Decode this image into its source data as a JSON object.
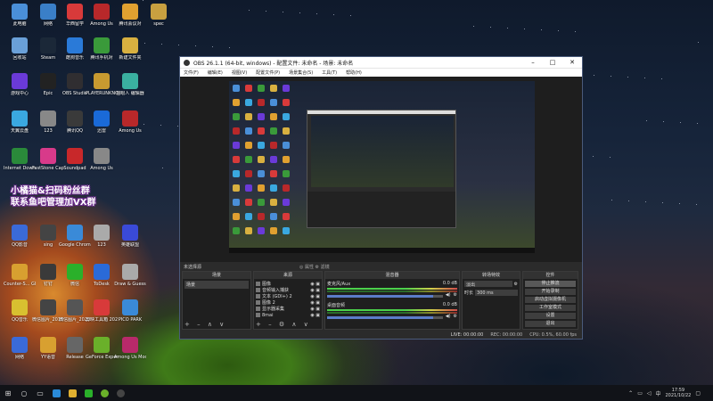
{
  "desktop": {
    "icons": [
      {
        "label": "此电脑",
        "color": "#4a8fd8"
      },
      {
        "label": "网络",
        "color": "#3a7fc8"
      },
      {
        "label": "华西留学",
        "color": "#d83a3a"
      },
      {
        "label": "Among Us",
        "color": "#b8282a"
      },
      {
        "label": "腾讯会议对",
        "color": "#e0a030"
      },
      {
        "label": "spec",
        "color": "#c8a040"
      },
      {
        "label": "回收站",
        "color": "#6aa0d8"
      },
      {
        "label": "Steam",
        "color": "#1b2838"
      },
      {
        "label": "酷狗音乐",
        "color": "#2a7ad8"
      },
      {
        "label": "腾讯手机对",
        "color": "#3a9a3a"
      },
      {
        "label": "新建文件夹",
        "color": "#d8b040"
      },
      {
        "label": "游戏中心",
        "color": "#6a3ad8"
      },
      {
        "label": "Epic",
        "color": "#222"
      },
      {
        "label": "OBS Studio",
        "color": "#302e31"
      },
      {
        "label": "PLAYERUNKNOWN'S BATTLEG...",
        "color": "#c89a30"
      },
      {
        "label": "猫眼人 编辑器",
        "color": "#3ab0a0"
      },
      {
        "label": "天翼云盘",
        "color": "#3aa8e0"
      },
      {
        "label": "123",
        "color": "#888"
      },
      {
        "label": "腾讯QQ",
        "color": "#3a3a3a"
      },
      {
        "label": "迅雷",
        "color": "#1a6ad8"
      },
      {
        "label": "Among Us",
        "color": "#b8282a"
      },
      {
        "label": "Internet Downlo...",
        "color": "#2a8a3a"
      },
      {
        "label": "FastStone Capture",
        "color": "#d83a8a"
      },
      {
        "label": "Soundpad",
        "color": "#c8282a"
      },
      {
        "label": "Among Us",
        "color": "#888"
      },
      {
        "label": "QQ影音",
        "color": "#3a6ad8"
      },
      {
        "label": "sing",
        "color": "#444"
      },
      {
        "label": "Google Chrome",
        "color": "#3a8ad8"
      },
      {
        "label": "123",
        "color": "#aaa"
      },
      {
        "label": "英雄联盟",
        "color": "#3a4ad8"
      },
      {
        "label": "Counter-S... Global Off...",
        "color": "#d8a030"
      },
      {
        "label": "钉钉",
        "color": "#3a3a3a"
      },
      {
        "label": "微信",
        "color": "#2ab02a"
      },
      {
        "label": "ToDesk",
        "color": "#2a6ad8"
      },
      {
        "label": "Draw & Guess",
        "color": "#aaa"
      },
      {
        "label": "QQ音乐",
        "color": "#d8c030"
      },
      {
        "label": "微信图片_2018101...",
        "color": "#444"
      },
      {
        "label": "微信图片_2020101...",
        "color": "#555"
      },
      {
        "label": "剪映工具箱 2020",
        "color": "#d83a3a"
      },
      {
        "label": "PICO PARK",
        "color": "#3a8ad8"
      },
      {
        "label": "网络",
        "color": "#3a6ad8"
      },
      {
        "label": "YY语音",
        "color": "#d8a030"
      },
      {
        "label": "Release",
        "color": "#666"
      },
      {
        "label": "GeForce Experience",
        "color": "#6ab02a"
      },
      {
        "label": "Among Us Mod...",
        "color": "#b82a6a"
      }
    ],
    "overlay_line1": "小橘猫&扫码粉丝群",
    "overlay_line2": "联系鱼吧管理加VX群"
  },
  "obs": {
    "title": "OBS 26.1.1 (64-bit, windows) - 配置文件: 未命名 - 场景: 未命名",
    "menu": [
      "文件(F)",
      "编辑(E)",
      "视图(V)",
      "配置文件(P)",
      "场景集合(S)",
      "工具(T)",
      "帮助(H)"
    ],
    "scene_status_left": "未选择源",
    "scene_status_mid": "◎ 属性  ⚙ 滤镜",
    "docks": {
      "scenes": {
        "header": "场景",
        "items": [
          "场景"
        ]
      },
      "sources": {
        "header": "来源",
        "items": [
          "图像",
          "音频输入捕获",
          "文本 (GDI+) 2",
          "图像 2",
          "显示器采集",
          "8mai"
        ]
      },
      "mixer": {
        "header": "混音器",
        "channels": [
          {
            "name": "麦克风/Aux",
            "level": "0.0 dB"
          },
          {
            "name": "桌面音频",
            "level": "0.0 dB"
          }
        ]
      },
      "transitions": {
        "header": "转场特效",
        "type": "淡出",
        "duration_label": "时长",
        "duration": "300 ms"
      },
      "controls": {
        "header": "控件",
        "buttons": [
          "停止推流",
          "开始录制",
          "启动虚拟摄像机",
          "工作室模式",
          "设置",
          "退出"
        ]
      }
    },
    "status": {
      "live": "LIVE: 00:00:00",
      "rec": "REC: 00:00:00",
      "cpu": "CPU: 0.5%, 60.00 fps"
    }
  },
  "taskbar": {
    "time": "17:59",
    "date": "2021/10/22"
  }
}
